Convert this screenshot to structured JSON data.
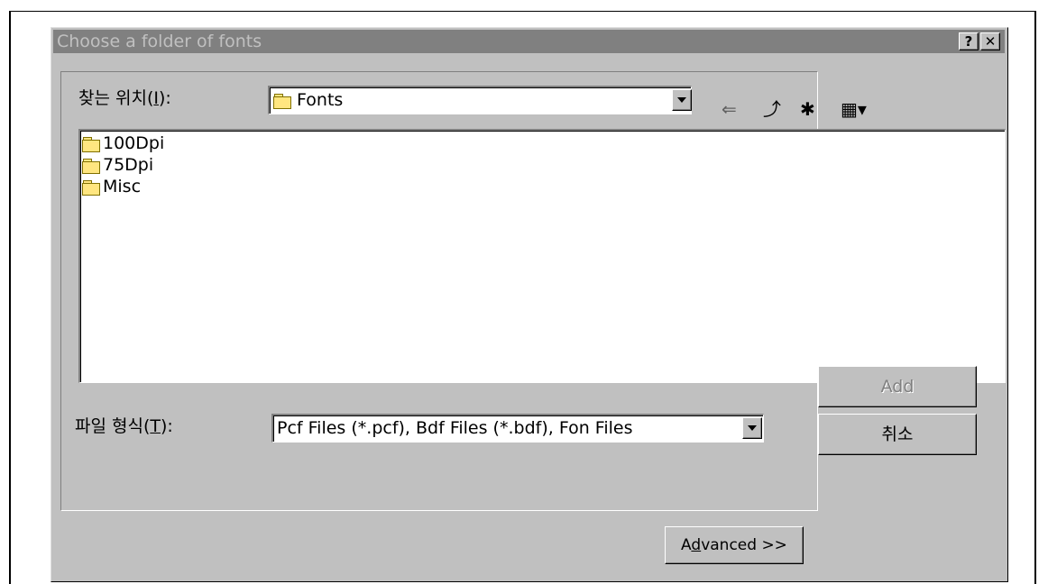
{
  "dialog": {
    "title": "Choose a folder of fonts",
    "help_label": "?",
    "close_label": "✕"
  },
  "look_in": {
    "label_prefix": "찾는 위치(",
    "label_accel": "I",
    "label_suffix": "):",
    "value": "Fonts"
  },
  "toolbar": {
    "back_glyph": "⇐",
    "up_glyph": "⤴",
    "new_folder_glyph": "✱",
    "view_glyph": "▦▾"
  },
  "files": [
    {
      "name": "100Dpi",
      "icon": "folder-icon"
    },
    {
      "name": "75Dpi",
      "icon": "folder-icon"
    },
    {
      "name": "Misc",
      "icon": "folder-icon"
    }
  ],
  "file_type": {
    "label_prefix": "파일 형식(",
    "label_accel": "T",
    "label_suffix": "):",
    "value": "Pcf Files (*.pcf), Bdf Files (*.bdf), Fon Files"
  },
  "buttons": {
    "add": "Add",
    "cancel": "취소",
    "advanced_prefix": "A",
    "advanced_accel": "d",
    "advanced_suffix": "vanced >>"
  }
}
